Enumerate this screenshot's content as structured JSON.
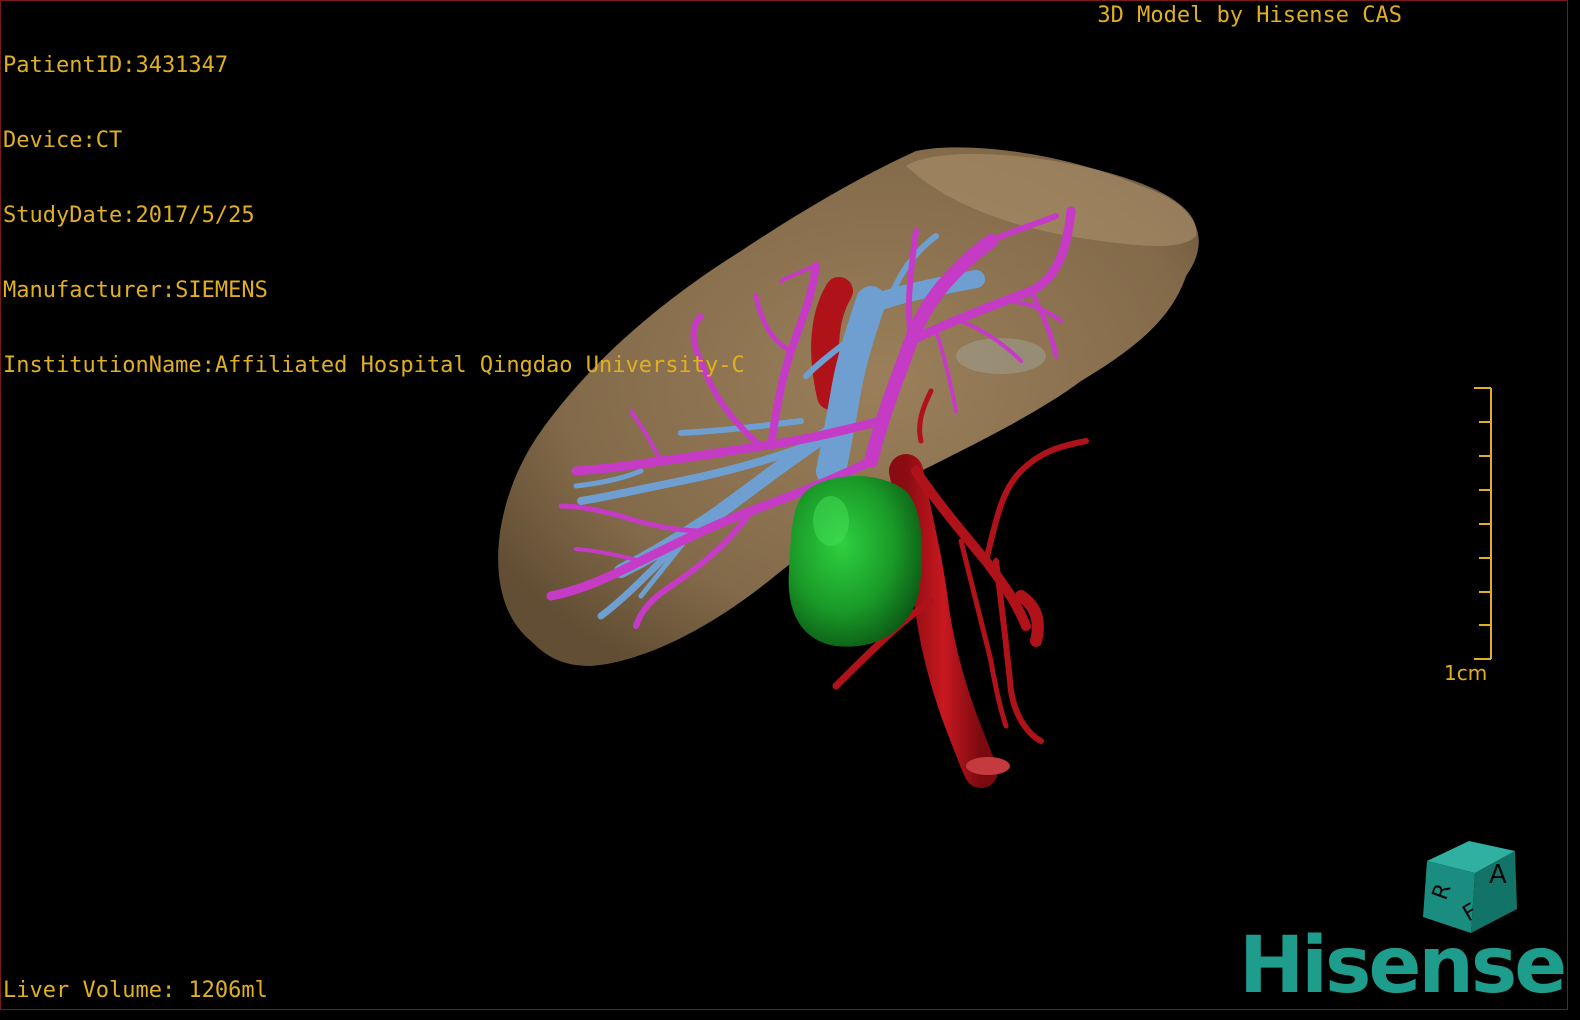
{
  "info": {
    "patient_id": "PatientID:3431347",
    "device": "Device:CT",
    "study_date": "StudyDate:2017/5/25",
    "manufacturer": "Manufacturer:SIEMENS",
    "institution": "InstitutionName:Affiliated Hospital Qingdao University-C"
  },
  "title": "3D Model by Hisense CAS",
  "liver_volume": "Liver Volume: 1206ml",
  "scale_bar": {
    "label": "1cm"
  },
  "orientation_cube": {
    "face_top": "A",
    "face_left": "R",
    "face_right": "F"
  },
  "brand": "Hisense",
  "colors": {
    "overlay_text": "#e0b020",
    "liver": "#9b7e5a",
    "hepatic_vein": "#c63bc6",
    "portal_vein": "#6e9fd0",
    "artery": "#b0121a",
    "tumor": "#1d9c2a",
    "brand": "#1e9c8c",
    "border": "#7a1b1b"
  },
  "structures": [
    "liver",
    "hepatic-vein",
    "portal-vein",
    "artery",
    "tumor"
  ]
}
